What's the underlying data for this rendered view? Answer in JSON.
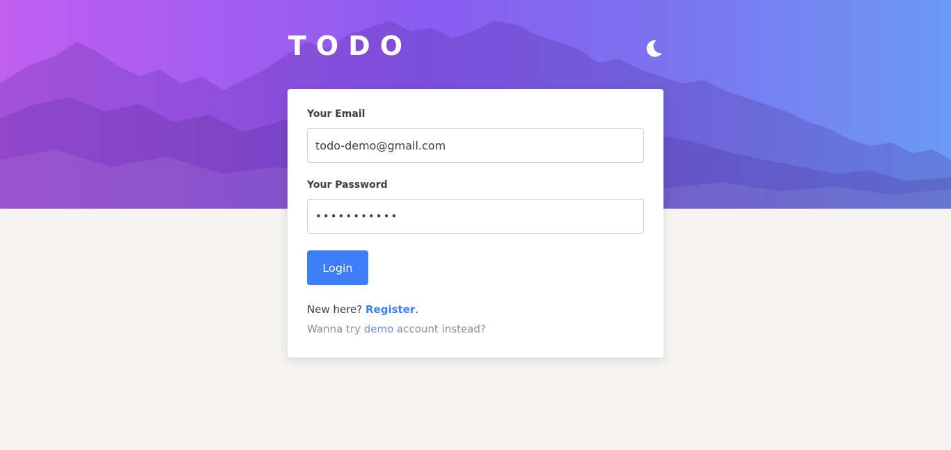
{
  "header": {
    "brand": "TODO",
    "theme_toggle_icon": "moon-icon"
  },
  "login_form": {
    "email_label": "Your Email",
    "email_value": "todo-demo@gmail.com",
    "password_label": "Your Password",
    "password_value": "•••••••••••",
    "login_button": "Login",
    "register_prompt": "New here? ",
    "register_link": "Register",
    "register_suffix": ".",
    "demo_prefix": "Wanna try ",
    "demo_link": "demo",
    "demo_suffix": " account instead?"
  },
  "colors": {
    "accent": "#3d7df6",
    "hero_gradient_start": "#c05ff0",
    "hero_gradient_end": "#6b9af4",
    "background": "#f5f4f2"
  }
}
